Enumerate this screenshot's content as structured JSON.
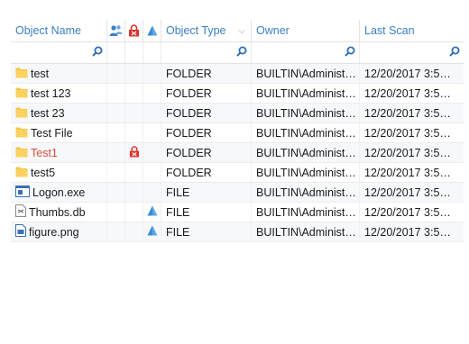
{
  "columns": {
    "name": "Object Name",
    "type": "Object Type",
    "owner": "Owner",
    "scan": "Last Scan",
    "icon1": "users-icon",
    "icon2": "lock-icon",
    "icon3": "triangle-icon"
  },
  "rows": [
    {
      "name": "test",
      "icon": "folder-icon",
      "type": "FOLDER",
      "owner": "BUILTIN\\Administ…",
      "scan": "12/20/2017 3:5…",
      "locked": false,
      "shared": false,
      "highlight": false
    },
    {
      "name": "test 123",
      "icon": "folder-icon",
      "type": "FOLDER",
      "owner": "BUILTIN\\Administ…",
      "scan": "12/20/2017 3:5…",
      "locked": false,
      "shared": false,
      "highlight": false
    },
    {
      "name": "test 23",
      "icon": "folder-icon",
      "type": "FOLDER",
      "owner": "BUILTIN\\Administ…",
      "scan": "12/20/2017 3:5…",
      "locked": false,
      "shared": false,
      "highlight": false
    },
    {
      "name": "Test File",
      "icon": "folder-icon",
      "type": "FOLDER",
      "owner": "BUILTIN\\Administ…",
      "scan": "12/20/2017 3:5…",
      "locked": false,
      "shared": false,
      "highlight": false
    },
    {
      "name": "Test1",
      "icon": "folder-icon",
      "type": "FOLDER",
      "owner": "BUILTIN\\Administ…",
      "scan": "12/20/2017 3:5…",
      "locked": true,
      "shared": false,
      "highlight": true
    },
    {
      "name": "test5",
      "icon": "folder-icon",
      "type": "FOLDER",
      "owner": "BUILTIN\\Administ…",
      "scan": "12/20/2017 3:5…",
      "locked": false,
      "shared": false,
      "highlight": false
    },
    {
      "name": "Logon.exe",
      "icon": "exe-file-icon",
      "type": "FILE",
      "owner": "BUILTIN\\Administ…",
      "scan": "12/20/2017 3:5…",
      "locked": false,
      "shared": false,
      "highlight": false
    },
    {
      "name": "Thumbs.db",
      "icon": "db-file-icon",
      "type": "FILE",
      "owner": "BUILTIN\\Administ…",
      "scan": "12/20/2017 3:5…",
      "locked": false,
      "shared": true,
      "highlight": false
    },
    {
      "name": "figure.png",
      "icon": "image-file-icon",
      "type": "FILE",
      "owner": "BUILTIN\\Administ…",
      "scan": "12/20/2017 3:5…",
      "locked": false,
      "shared": true,
      "highlight": false
    }
  ],
  "colors": {
    "header": "#3c7fc4",
    "highlight": "#e14b3b",
    "folder": "#f7c64a",
    "triangle": "#5aa9e6",
    "lock": "#d9342b"
  }
}
